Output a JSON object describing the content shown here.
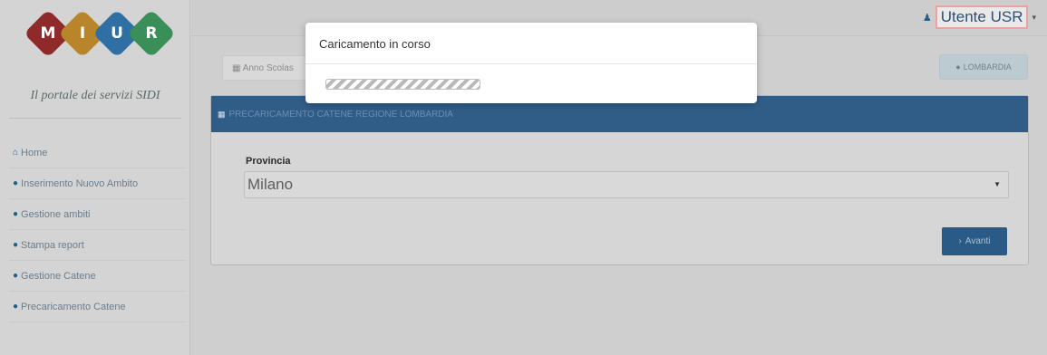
{
  "logo": {
    "letters": [
      "M",
      "I",
      "U",
      "R"
    ],
    "colors": [
      "#8e2a2a",
      "#b9852a",
      "#2f6fa4",
      "#3a8e58"
    ]
  },
  "portal_title": "Il portale dei servizi SIDI",
  "sidebar": {
    "items": [
      {
        "label": "Home",
        "icon": "home-icon"
      },
      {
        "label": "Inserimento Nuovo Ambito",
        "icon": "circle-plus-icon"
      },
      {
        "label": "Gestione ambiti",
        "icon": "circle-plus-icon"
      },
      {
        "label": "Stampa report",
        "icon": "circle-plus-icon"
      },
      {
        "label": "Gestione Catene",
        "icon": "circle-plus-icon"
      },
      {
        "label": "Precaricamento Catene",
        "icon": "circle-plus-icon"
      }
    ]
  },
  "header": {
    "user_label": "Utente USR",
    "user_icon": "user-icon"
  },
  "toolbar": {
    "year_label": "Anno Scolas",
    "region_label": "LOMBARDIA"
  },
  "panel": {
    "title": "PRECARICAMENTO CATENE REGIONE LOMBARDIA",
    "province_label": "Provincia",
    "province_value": "Milano",
    "next_label": "Avanti"
  },
  "modal": {
    "title": "Caricamento in corso",
    "progress": 1.0
  },
  "colors": {
    "primary": "#305d88",
    "user_outline": "#e8a3a3"
  }
}
